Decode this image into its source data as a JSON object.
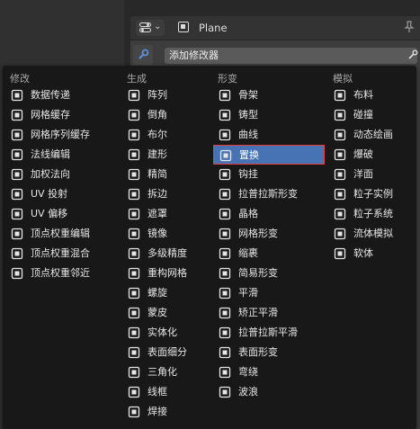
{
  "window": {
    "object_name": "Plane",
    "add_modifier_label": "添加修改器"
  },
  "menu": {
    "columns": [
      {
        "header": "修改",
        "items": [
          {
            "label": "数据传递",
            "icon": "data-transfer-icon"
          },
          {
            "label": "网格缓存",
            "icon": "mesh-cache-icon"
          },
          {
            "label": "网格序列缓存",
            "icon": "mesh-sequence-cache-icon"
          },
          {
            "label": "法线编辑",
            "icon": "normal-edit-icon"
          },
          {
            "label": "加权法向",
            "icon": "weighted-normal-icon"
          },
          {
            "label": "UV 投射",
            "icon": "uv-project-icon"
          },
          {
            "label": "UV 偏移",
            "icon": "uv-warp-icon"
          },
          {
            "label": "顶点权重编辑",
            "icon": "vertex-weight-edit-icon"
          },
          {
            "label": "顶点权重混合",
            "icon": "vertex-weight-mix-icon"
          },
          {
            "label": "顶点权重邻近",
            "icon": "vertex-weight-proximity-icon"
          }
        ]
      },
      {
        "header": "生成",
        "items": [
          {
            "label": "阵列",
            "icon": "array-icon"
          },
          {
            "label": "倒角",
            "icon": "bevel-icon"
          },
          {
            "label": "布尔",
            "icon": "boolean-icon"
          },
          {
            "label": "建形",
            "icon": "build-icon"
          },
          {
            "label": "精简",
            "icon": "decimate-icon"
          },
          {
            "label": "拆边",
            "icon": "edge-split-icon"
          },
          {
            "label": "遮罩",
            "icon": "mask-icon"
          },
          {
            "label": "镜像",
            "icon": "mirror-icon"
          },
          {
            "label": "多级精度",
            "icon": "multires-icon"
          },
          {
            "label": "重构网格",
            "icon": "remesh-icon"
          },
          {
            "label": "螺旋",
            "icon": "screw-icon"
          },
          {
            "label": "蒙皮",
            "icon": "skin-icon"
          },
          {
            "label": "实体化",
            "icon": "solidify-icon"
          },
          {
            "label": "表面细分",
            "icon": "subdivision-icon"
          },
          {
            "label": "三角化",
            "icon": "triangulate-icon"
          },
          {
            "label": "线框",
            "icon": "wireframe-icon"
          },
          {
            "label": "焊接",
            "icon": "weld-icon"
          }
        ]
      },
      {
        "header": "形变",
        "items": [
          {
            "label": "骨架",
            "icon": "armature-icon"
          },
          {
            "label": "铸型",
            "icon": "cast-icon"
          },
          {
            "label": "曲线",
            "icon": "curve-icon"
          },
          {
            "label": "置换",
            "icon": "displace-icon",
            "selected": true
          },
          {
            "label": "钩挂",
            "icon": "hook-icon"
          },
          {
            "label": "拉普拉斯形变",
            "icon": "laplacian-deform-icon"
          },
          {
            "label": "晶格",
            "icon": "lattice-icon"
          },
          {
            "label": "网格形变",
            "icon": "mesh-deform-icon"
          },
          {
            "label": "缩裹",
            "icon": "shrinkwrap-icon"
          },
          {
            "label": "简易形变",
            "icon": "simple-deform-icon"
          },
          {
            "label": "平滑",
            "icon": "smooth-icon"
          },
          {
            "label": "矫正平滑",
            "icon": "corrective-smooth-icon"
          },
          {
            "label": "拉普拉斯平滑",
            "icon": "laplacian-smooth-icon"
          },
          {
            "label": "表面形变",
            "icon": "surface-deform-icon"
          },
          {
            "label": "弯绕",
            "icon": "warp-icon"
          },
          {
            "label": "波浪",
            "icon": "wave-icon"
          }
        ]
      },
      {
        "header": "模拟",
        "items": [
          {
            "label": "布料",
            "icon": "cloth-icon"
          },
          {
            "label": "碰撞",
            "icon": "collision-icon"
          },
          {
            "label": "动态绘画",
            "icon": "dynamic-paint-icon"
          },
          {
            "label": "爆破",
            "icon": "explode-icon"
          },
          {
            "label": "洋面",
            "icon": "ocean-icon"
          },
          {
            "label": "粒子实例",
            "icon": "particle-instance-icon"
          },
          {
            "label": "粒子系统",
            "icon": "particle-system-icon"
          },
          {
            "label": "流体模拟",
            "icon": "fluid-icon"
          },
          {
            "label": "软体",
            "icon": "soft-body-icon"
          }
        ]
      }
    ]
  }
}
